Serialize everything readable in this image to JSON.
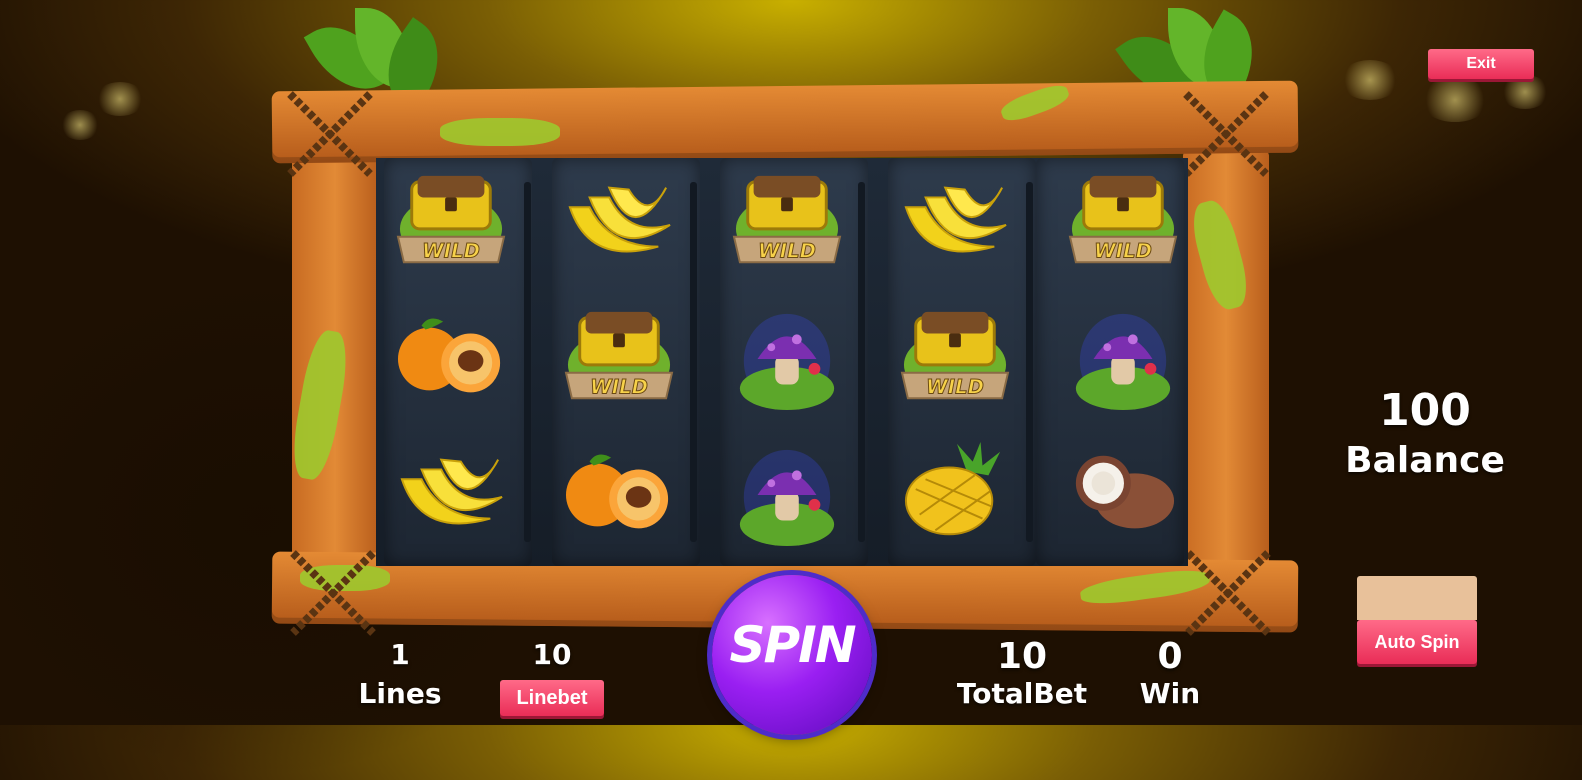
{
  "exit_label": "Exit",
  "balance": {
    "value": "100",
    "label": "Balance"
  },
  "lines": {
    "value": "1",
    "label": "Lines"
  },
  "linebet": {
    "value": "10",
    "label": "Linebet"
  },
  "spin_label": "SPIN",
  "totalbet": {
    "value": "10",
    "label": "TotalBet"
  },
  "win": {
    "value": "0",
    "label": "Win"
  },
  "auto_spin_label": "Auto Spin",
  "wild_text": "WILD",
  "reel_grid": [
    [
      "wild-chest-icon",
      "banana-icon",
      "wild-chest-icon",
      "banana-icon",
      "wild-chest-icon"
    ],
    [
      "orange-icon",
      "wild-chest-icon",
      "mushroom-icon",
      "wild-chest-icon",
      "mushroom-icon"
    ],
    [
      "banana-icon",
      "orange-icon",
      "mushroom-icon",
      "pineapple-icon",
      "coconut-icon"
    ]
  ],
  "colors": {
    "button": "#e92d57",
    "spin": "#9a1ff2",
    "frame": "#d17428",
    "slime": "#9dc92e"
  }
}
